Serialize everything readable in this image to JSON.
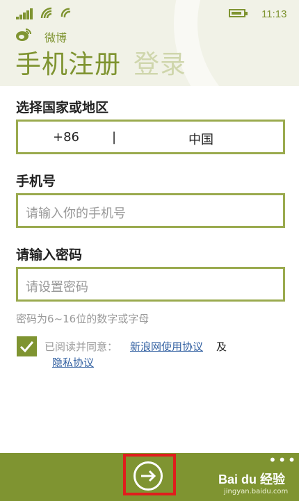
{
  "status": {
    "time": "11:13"
  },
  "brand": {
    "name": "微博"
  },
  "tabs": {
    "active": "手机注册",
    "inactive": "登录"
  },
  "region": {
    "label": "选择国家或地区",
    "code": "+86",
    "separator": "|",
    "country": "中国"
  },
  "phone": {
    "label": "手机号",
    "placeholder": "请输入你的手机号"
  },
  "password": {
    "label": "请输入密码",
    "placeholder": "请设置密码",
    "hint": "密码为6~16位的数字或字母"
  },
  "agreement": {
    "checked": true,
    "prefix": "已阅读并同意：",
    "terms_link": "新浪网使用协议",
    "and": "及",
    "privacy_link": "隐私协议"
  },
  "appbar": {
    "next_icon": "arrow-right-circle-icon",
    "more": "•••"
  },
  "watermark": {
    "brand": "Bai du 经验",
    "url": "jingyan.baidu.com"
  },
  "colors": {
    "accent": "#7f9431",
    "inputBorder": "#9aaa4e",
    "link": "#2f5ea0",
    "highlight": "#e01d1d"
  }
}
